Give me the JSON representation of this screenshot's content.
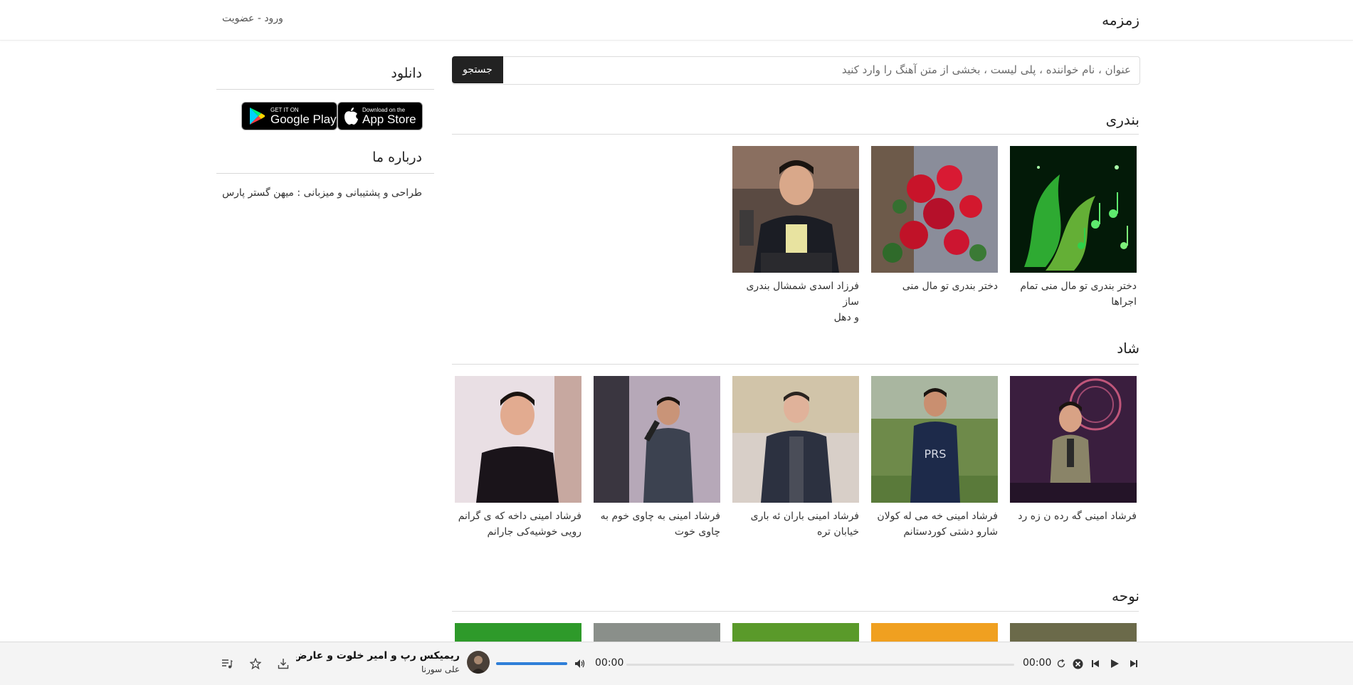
{
  "header": {
    "brand": "زمزمه",
    "login_link": "ورود - عضویت"
  },
  "search": {
    "placeholder": "عنوان ، نام خواننده ، پلی لیست ، بخشی از متن آهنگ را وارد کنید",
    "button_label": "جستجو"
  },
  "sections": [
    {
      "title": "بندری",
      "items": [
        {
          "title_line1": "دختر بندری تو مال منی تمام",
          "title_line2": "اجراها"
        },
        {
          "title_line1": "دختر بندری تو مال منی",
          "title_line2": ""
        },
        {
          "title_line1": "فرزاد اسدی شمشال بندری ساز",
          "title_line2": "و دهل"
        }
      ]
    },
    {
      "title": "شاد",
      "items": [
        {
          "title_line1": "فرشاد امینی گه رده ن زه رد",
          "title_line2": ""
        },
        {
          "title_line1": "فرشاد امینی خه می له کولان",
          "title_line2": "شارو دشتی کوردستانم"
        },
        {
          "title_line1": "فرشاد امینی باران ئه باری",
          "title_line2": "خیابان تره"
        },
        {
          "title_line1": "فرشاد امینی به چاوی خوم به",
          "title_line2": "چاوی خوت"
        },
        {
          "title_line1": "فرشاد امینی داخه که ی گرانم",
          "title_line2": "رویی خوشیه‌کی جارانم"
        }
      ]
    },
    {
      "title": "نوحه",
      "items": []
    }
  ],
  "sidebar": {
    "download_title": "دانلود",
    "google_play": {
      "small": "GET IT ON",
      "big": "Google Play"
    },
    "app_store": {
      "small": "Download on the",
      "big": "App Store"
    },
    "about_title": "درباره ما",
    "about_text": "طراحی و پشتیبانی و میزبانی : میهن گستر پارس"
  },
  "player": {
    "track_title": "ریمیکس رپ و امیر خلوت و عارض فکر و ...",
    "artist": "علی سورنا",
    "current_time": "00:00",
    "duration": "00:00",
    "progress": 0,
    "volume": 1.0,
    "icons": [
      "next-icon",
      "play-icon",
      "previous-icon",
      "close-icon",
      "repeat-icon",
      "volume-icon",
      "download-icon",
      "star-icon",
      "playlist-icon"
    ]
  },
  "colors": {
    "accent": "#2f7fd8",
    "button_dark": "#222222",
    "player_bg": "#f4f4f4"
  }
}
